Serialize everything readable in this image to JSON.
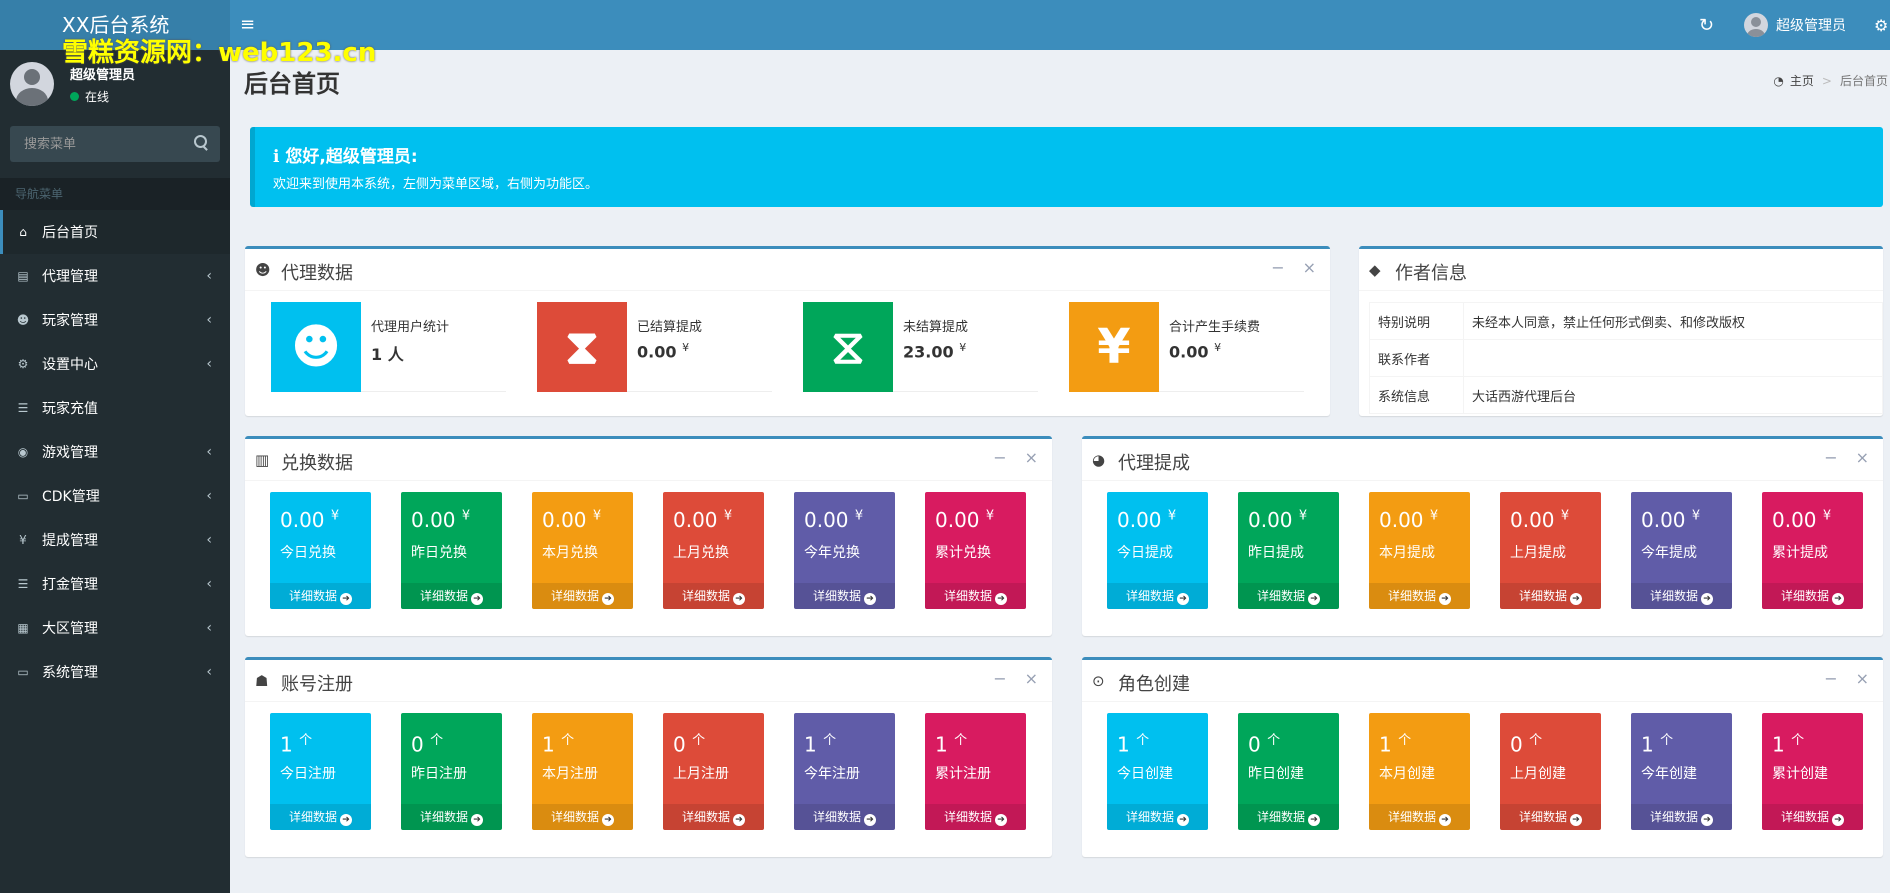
{
  "app": {
    "title": "XX后台系统",
    "watermark": "雪糕资源网：web123.cn",
    "toggle_icon": "bars-icon",
    "top_username": "超级管理员"
  },
  "sidebar": {
    "username": "超级管理员",
    "status": "在线",
    "search_placeholder": "搜索菜单",
    "nav_header": "导航菜单",
    "items": [
      {
        "label": "后台首页",
        "icon": "⌂",
        "has_children": false,
        "active": true
      },
      {
        "label": "代理管理",
        "icon": "▤",
        "has_children": true
      },
      {
        "label": "玩家管理",
        "icon": "☻",
        "has_children": true
      },
      {
        "label": "设置中心",
        "icon": "⚙",
        "has_children": true
      },
      {
        "label": "玩家充值",
        "icon": "☰",
        "has_children": false
      },
      {
        "label": "游戏管理",
        "icon": "◉",
        "has_children": true
      },
      {
        "label": "CDK管理",
        "icon": "▭",
        "has_children": true
      },
      {
        "label": "提成管理",
        "icon": "¥",
        "has_children": true
      },
      {
        "label": "打金管理",
        "icon": "☰",
        "has_children": true
      },
      {
        "label": "大区管理",
        "icon": "▦",
        "has_children": true
      },
      {
        "label": "系统管理",
        "icon": "▭",
        "has_children": true
      }
    ]
  },
  "header": {
    "page_title": "后台首页",
    "breadcrumb_home": "主页",
    "breadcrumb_sep": ">",
    "breadcrumb_current": "后台首页"
  },
  "callout": {
    "title": "ℹ 您好,超级管理员:",
    "text": "欢迎来到使用本系统，左侧为菜单区域，右侧为功能区。"
  },
  "colors": {
    "aqua": "#00c0ef",
    "green": "#00a65a",
    "yellow": "#f39c12",
    "red": "#dd4b39",
    "purple": "#605ca8",
    "maroon": "#d81b60",
    "primary": "#3c8dbc"
  },
  "agent_box": {
    "title": "代理数据",
    "items": [
      {
        "label": "代理用户统计",
        "value": "1 人",
        "unit": ""
      },
      {
        "label": "已结算提成",
        "value": "0.00",
        "unit": "¥"
      },
      {
        "label": "未结算提成",
        "value": "23.00",
        "unit": "¥"
      },
      {
        "label": "合计产生手续费",
        "value": "0.00",
        "unit": "¥"
      }
    ]
  },
  "author_box": {
    "title": "作者信息",
    "rows": [
      {
        "key": "特别说明",
        "value": "未经本人同意，禁止任何形式倒卖、和修改版权"
      },
      {
        "key": "联系作者",
        "value": ""
      },
      {
        "key": "系统信息",
        "value": "大话西游代理后台"
      }
    ]
  },
  "detail_label": "详细数据",
  "stat_boxes": {
    "exchange": {
      "title": "兑换数据",
      "items": [
        {
          "value": "0.00",
          "unit": "¥",
          "label": "今日兑换"
        },
        {
          "value": "0.00",
          "unit": "¥",
          "label": "昨日兑换"
        },
        {
          "value": "0.00",
          "unit": "¥",
          "label": "本月兑换"
        },
        {
          "value": "0.00",
          "unit": "¥",
          "label": "上月兑换"
        },
        {
          "value": "0.00",
          "unit": "¥",
          "label": "今年兑换"
        },
        {
          "value": "0.00",
          "unit": "¥",
          "label": "累计兑换"
        }
      ]
    },
    "commission": {
      "title": "代理提成",
      "items": [
        {
          "value": "0.00",
          "unit": "¥",
          "label": "今日提成"
        },
        {
          "value": "0.00",
          "unit": "¥",
          "label": "昨日提成"
        },
        {
          "value": "0.00",
          "unit": "¥",
          "label": "本月提成"
        },
        {
          "value": "0.00",
          "unit": "¥",
          "label": "上月提成"
        },
        {
          "value": "0.00",
          "unit": "¥",
          "label": "今年提成"
        },
        {
          "value": "0.00",
          "unit": "¥",
          "label": "累计提成"
        }
      ]
    },
    "register": {
      "title": "账号注册",
      "items": [
        {
          "value": "1",
          "unit": "个",
          "label": "今日注册"
        },
        {
          "value": "0",
          "unit": "个",
          "label": "昨日注册"
        },
        {
          "value": "1",
          "unit": "个",
          "label": "本月注册"
        },
        {
          "value": "0",
          "unit": "个",
          "label": "上月注册"
        },
        {
          "value": "1",
          "unit": "个",
          "label": "今年注册"
        },
        {
          "value": "1",
          "unit": "个",
          "label": "累计注册"
        }
      ]
    },
    "roles": {
      "title": "角色创建",
      "items": [
        {
          "value": "1",
          "unit": "个",
          "label": "今日创建"
        },
        {
          "value": "0",
          "unit": "个",
          "label": "昨日创建"
        },
        {
          "value": "1",
          "unit": "个",
          "label": "本月创建"
        },
        {
          "value": "0",
          "unit": "个",
          "label": "上月创建"
        },
        {
          "value": "1",
          "unit": "个",
          "label": "今年创建"
        },
        {
          "value": "1",
          "unit": "个",
          "label": "累计创建"
        }
      ]
    }
  }
}
